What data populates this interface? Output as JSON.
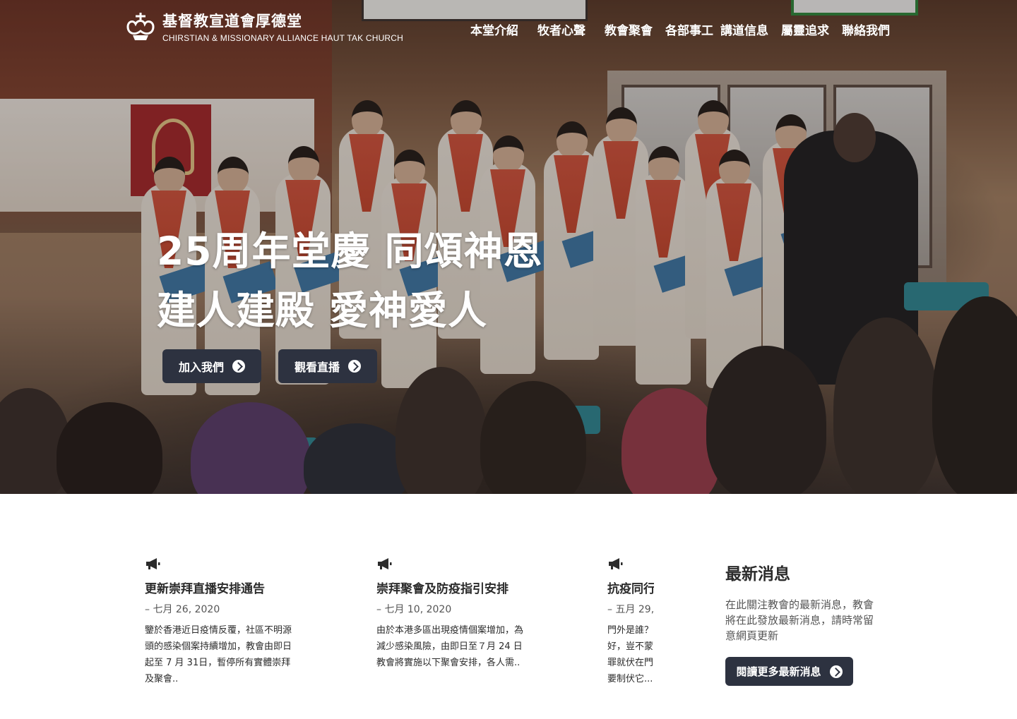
{
  "header": {
    "brand_name": "基督教宣道會厚德堂",
    "brand_sub": "CHIRSTIAN & MISSIONARY ALLIANCE HAUT TAK CHURCH",
    "nav": [
      "本堂介紹",
      "牧者心聲",
      "教會聚會",
      "各部事工",
      "講道信息",
      "屬靈追求",
      "聯絡我們"
    ]
  },
  "hero": {
    "title_line1": "25周年堂慶 同頌神恩",
    "title_line2": "建人建殿 愛神愛人",
    "join_label": "加入我們",
    "live_label": "觀看直播"
  },
  "news": [
    {
      "icon": "megaphone-icon",
      "title": "更新崇拜直播安排通告",
      "date": "– 七月 26, 2020",
      "excerpt": "鑒於香港近日疫情反覆，社區不明源頭的感染個案持續增加，教會由即日起至 7 月 31日，暫停所有實體崇拜及聚會.."
    },
    {
      "icon": "megaphone-icon",
      "title": "崇拜聚會及防疫指引安排",
      "date": "– 七月 10, 2020",
      "excerpt": "由於本港多區出現疫情個案增加，為減少感染風險，由即日至７月 24 日教會將實施以下聚會安排，各人需.."
    },
    {
      "icon": "megaphone-icon",
      "title": "抗疫同行",
      "date": "– 五月 29,",
      "excerpt": "門外是誰？好，豈不蒙罪就伏在門要制伏它..."
    }
  ],
  "latest": {
    "title": "最新消息",
    "description": "在此關注教會的最新消息，教會將在此發放最新消息，請時常留意網頁更新",
    "button_label": "閱讀更多最新消息"
  },
  "colors": {
    "button_bg": "#2d3240",
    "text_dark": "#2b2b2b",
    "text_muted": "#555555"
  }
}
